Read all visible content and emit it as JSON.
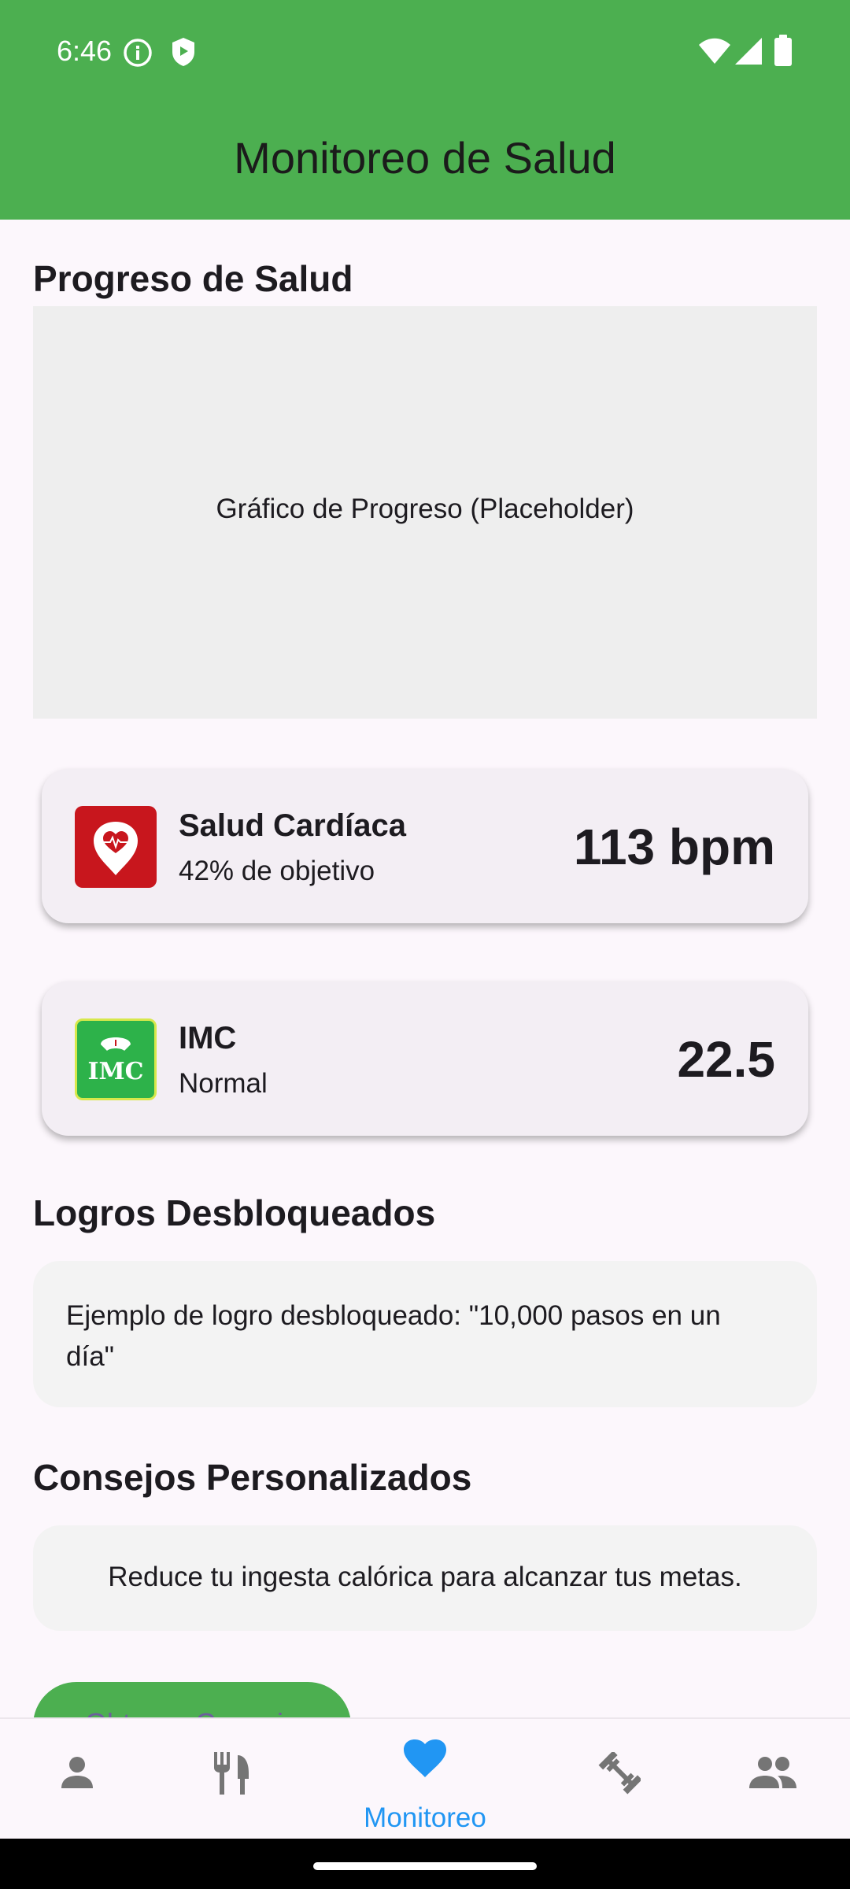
{
  "status_bar": {
    "time": "6:46",
    "icons": [
      "info-icon",
      "shield-icon",
      "wifi-icon",
      "signal-icon",
      "battery-icon"
    ]
  },
  "app_bar": {
    "title": "Monitoreo de Salud",
    "color": "#4CAF50"
  },
  "progress": {
    "title": "Progreso de Salud",
    "placeholder": "Gráfico de Progreso (Placeholder)"
  },
  "cards": [
    {
      "icon": "heart-pin-icon",
      "title": "Salud Cardíaca",
      "subtitle": "42% de objetivo",
      "value": "113 bpm",
      "icon_color": "#C8161D"
    },
    {
      "icon": "imc-scale-icon",
      "title": "IMC",
      "subtitle": "Normal",
      "value": "22.5",
      "icon_color": "#2DB24A",
      "icon_text": "IMC"
    }
  ],
  "achievements": {
    "title": "Logros Desbloqueados",
    "text": "Ejemplo de logro desbloqueado: \"10,000 pasos en un día\""
  },
  "advice": {
    "title": "Consejos Personalizados",
    "text": "Reduce tu ingesta calórica para alcanzar tus metas.",
    "button_label": "Obtener Consejo"
  },
  "bottom_nav": {
    "items": [
      {
        "icon": "person-icon",
        "label": ""
      },
      {
        "icon": "restaurant-icon",
        "label": ""
      },
      {
        "icon": "heart-icon",
        "label": "Monitoreo",
        "active": true
      },
      {
        "icon": "fitness-icon",
        "label": ""
      },
      {
        "icon": "people-icon",
        "label": ""
      }
    ],
    "active_color": "#2196F3",
    "inactive_color": "#757575"
  }
}
